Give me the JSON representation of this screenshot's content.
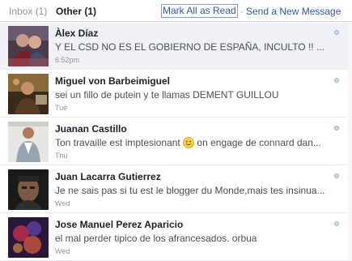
{
  "header": {
    "inbox_tab": "Inbox (1)",
    "other_tab": "Other (1)",
    "mark_all_read": "Mark All as Read",
    "separator": "·",
    "send_new_message": "Send a New Message"
  },
  "messages": [
    {
      "name": "Àlex Díaz",
      "snippet": "Y EL CSD NO ES EL GOBIERNO DE ESPAÑA, INCULTO !! ...",
      "time": "6:52pm",
      "unread": true
    },
    {
      "name": "Miguel von Barbeimiguel",
      "snippet": "sei un fillo de putein y te llamas DEMENT GUILLOU",
      "time": "Tue",
      "unread": false
    },
    {
      "name": "Juanan Castillo",
      "snippet_before": "Ton travaille est imptesionant",
      "snippet_after": " on engage de connard dan...",
      "time": "Thu",
      "unread": false
    },
    {
      "name": "Juan Lacarra Gutierrez",
      "snippet": "Je ne sais pas si tu est le blogger du Monde,mais tes insinua...",
      "time": "Wed",
      "unread": false
    },
    {
      "name": "Jose Manuel Perez Aparicio",
      "snippet": "el mal perder tipico de los afrancesados. orbua",
      "time": "Wed",
      "unread": false
    }
  ]
}
